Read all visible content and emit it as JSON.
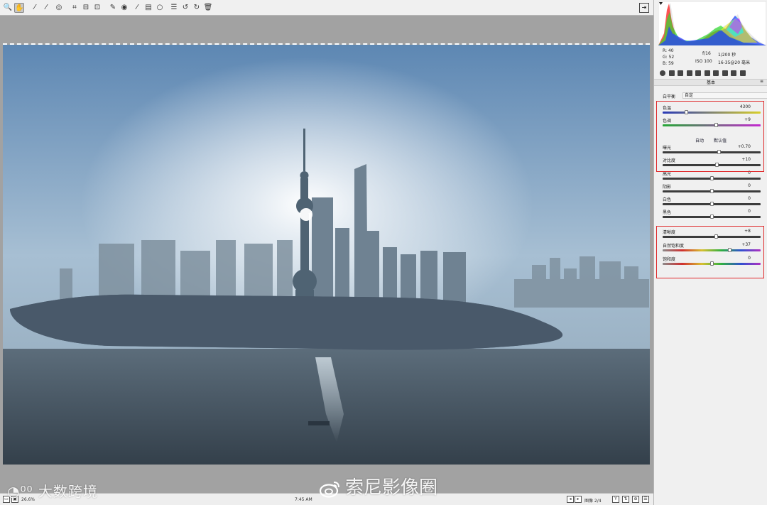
{
  "toolbar": {
    "tools": [
      {
        "name": "zoom-tool",
        "glyph": "🔍"
      },
      {
        "name": "hand-tool",
        "glyph": "✋"
      },
      {
        "name": "white-balance-tool",
        "glyph": "⁄"
      },
      {
        "name": "color-sampler-tool",
        "glyph": "⁄"
      },
      {
        "name": "targeted-adjustment-tool",
        "glyph": "◎"
      },
      {
        "name": "crop-tool",
        "glyph": "⌗"
      },
      {
        "name": "straighten-tool",
        "glyph": "⊟"
      },
      {
        "name": "transform-tool",
        "glyph": "⊡"
      },
      {
        "name": "spot-removal-tool",
        "glyph": "✎"
      },
      {
        "name": "red-eye-tool",
        "glyph": "◉"
      },
      {
        "name": "adjustment-brush-tool",
        "glyph": "⁄"
      },
      {
        "name": "graduated-filter-tool",
        "glyph": "▤"
      },
      {
        "name": "radial-filter-tool",
        "glyph": "○"
      },
      {
        "name": "preferences-tool",
        "glyph": "☰"
      },
      {
        "name": "rotate-left-tool",
        "glyph": "↺"
      },
      {
        "name": "rotate-right-tool",
        "glyph": "↻"
      },
      {
        "name": "trash-tool",
        "glyph": "🗑"
      }
    ],
    "fullscreen_glyph": "⇥"
  },
  "status": {
    "zoom": "26.6%",
    "capture_time": "7:45 AM",
    "image_count": "图像 2/4"
  },
  "watermarks": {
    "left": "大数跨境",
    "center": "索尼影像圈"
  },
  "camera": {
    "r_label": "R:",
    "r_value": "40",
    "g_label": "G:",
    "g_value": "52",
    "b_label": "B:",
    "b_value": "59",
    "aperture": "f/16",
    "shutter": "1/200 秒",
    "iso": "ISO 100",
    "lens": "16-35@20 毫米"
  },
  "panel": {
    "title": "基本",
    "white_balance_label": "白平衡",
    "white_balance_value": "自定",
    "auto_label": "自动",
    "default_label": "默认值",
    "sliders": [
      {
        "key": "temp",
        "label": "色温",
        "value": "4300",
        "level": 0.24,
        "track": "temp"
      },
      {
        "key": "tint",
        "label": "色调",
        "value": "+9",
        "level": 0.54,
        "track": "tint"
      },
      {
        "key": "exposure",
        "label": "曝光",
        "value": "+0.70",
        "level": 0.57,
        "track": "gray"
      },
      {
        "key": "contrast",
        "label": "对比度",
        "value": "+10",
        "level": 0.55,
        "track": "gray"
      },
      {
        "key": "highlights",
        "label": "高光",
        "value": "0",
        "level": 0.5,
        "track": "gray"
      },
      {
        "key": "shadows",
        "label": "阴影",
        "value": "0",
        "level": 0.5,
        "track": "gray"
      },
      {
        "key": "whites",
        "label": "白色",
        "value": "0",
        "level": 0.5,
        "track": "gray"
      },
      {
        "key": "blacks",
        "label": "黑色",
        "value": "0",
        "level": 0.5,
        "track": "gray"
      },
      {
        "key": "clarity",
        "label": "清晰度",
        "value": "+8",
        "level": 0.54,
        "track": "gray"
      },
      {
        "key": "vibrance",
        "label": "自然饱和度",
        "value": "+37",
        "level": 0.68,
        "track": "vibrance"
      },
      {
        "key": "saturation",
        "label": "饱和度",
        "value": "0",
        "level": 0.5,
        "track": "saturation"
      }
    ]
  },
  "colors": {
    "highlight_box": "#e0282a",
    "panel_bg": "#f0f0f0"
  }
}
